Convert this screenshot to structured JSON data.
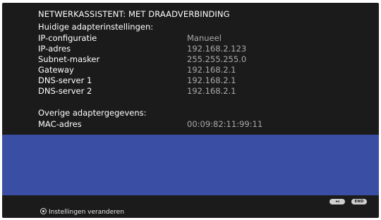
{
  "header": {
    "title": "NETWERKASSISTENT: MET DRAADVERBINDING"
  },
  "current_settings": {
    "label": "Huidige adapterinstellingen:",
    "rows": [
      {
        "key": "IP-configuratie",
        "value": "Manueel"
      },
      {
        "key": "IP-adres",
        "value": "192.168.2.123"
      },
      {
        "key": "Subnet-masker",
        "value": "255.255.255.0"
      },
      {
        "key": "Gateway",
        "value": "192.168.2.1"
      },
      {
        "key": "DNS-server 1",
        "value": "192.168.2.1"
      },
      {
        "key": "DNS-server 2",
        "value": "192.168.2.1"
      }
    ]
  },
  "other_details": {
    "label": "Overige adaptergegevens:",
    "rows": [
      {
        "key": "MAC-adres",
        "value": "00:09:82:11:99:11"
      }
    ]
  },
  "footer": {
    "back_button": "◂◂",
    "end_button": "END",
    "hint_icon": "ok-icon",
    "hint_text": "Instellingen veranderen"
  },
  "colors": {
    "background": "#1b1b1b",
    "panel": "#3a4ea3",
    "value_text": "#a9a9a9"
  }
}
